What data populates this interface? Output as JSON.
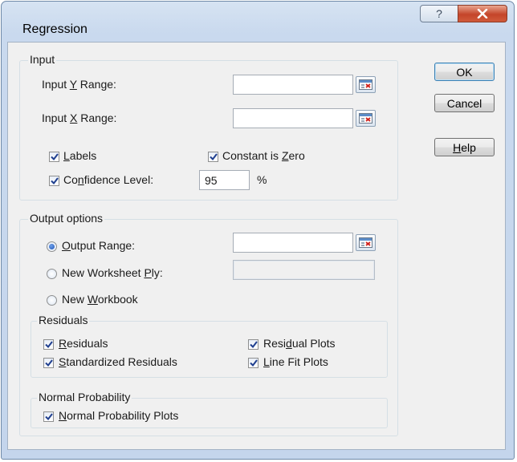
{
  "dialog": {
    "title": "Regression"
  },
  "titlebar": {
    "help_glyph": "?"
  },
  "buttons": {
    "ok": "OK",
    "cancel": "Cancel",
    "help": "Help"
  },
  "input_group": {
    "title": "Input",
    "y_range_label": "Input Y Range:",
    "y_range_value": "",
    "x_range_label": "Input X Range:",
    "x_range_value": "",
    "labels_label": "Labels",
    "labels_checked": true,
    "constant_zero_label": "Constant is Zero",
    "constant_zero_checked": true,
    "confidence_label": "Confidence Level:",
    "confidence_checked": true,
    "confidence_value": "95",
    "percent_sign": "%"
  },
  "output_group": {
    "title": "Output options",
    "output_range_label": "Output Range:",
    "output_range_value": "",
    "new_worksheet_label": "New Worksheet Ply:",
    "new_worksheet_value": "",
    "new_workbook_label": "New Workbook",
    "selected_option": "Output Range"
  },
  "residuals_group": {
    "title": "Residuals",
    "residuals_label": "Residuals",
    "standardized_label": "Standardized Residuals",
    "residual_plots_label": "Residual Plots",
    "line_fit_label": "Line Fit Plots",
    "all_checked": true
  },
  "normal_group": {
    "title": "Normal Probability",
    "plots_label": "Normal Probability Plots",
    "plots_checked": true
  },
  "icons": {
    "range_picker": "collapse-dialog-icon",
    "check": "checkmark-icon",
    "close": "close-icon",
    "help": "question-mark-icon"
  }
}
